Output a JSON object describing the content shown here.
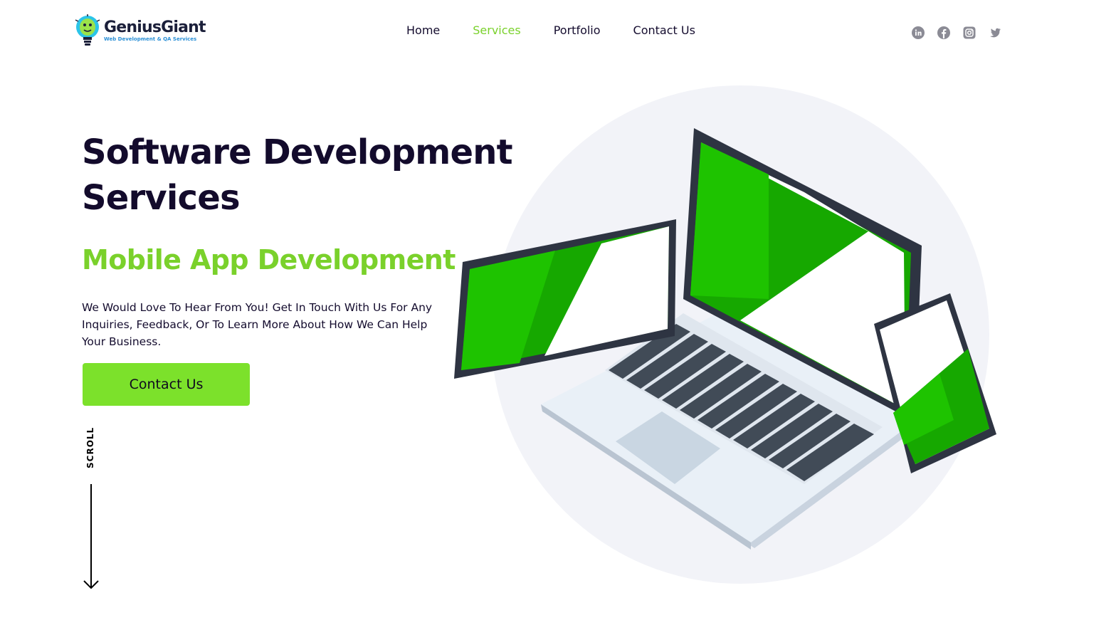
{
  "brand": {
    "name": "GeniusGiant",
    "tagline": "Web Development & QA Services"
  },
  "nav": {
    "items": [
      {
        "label": "Home",
        "active": false
      },
      {
        "label": "Services",
        "active": true
      },
      {
        "label": "Portfolio",
        "active": false
      },
      {
        "label": "Contact Us",
        "active": false
      }
    ]
  },
  "social": {
    "icons": [
      "linkedin-icon",
      "facebook-icon",
      "instagram-icon",
      "twitter-icon"
    ]
  },
  "hero": {
    "title": "Software Development Services",
    "subtitle": "Mobile App Development",
    "description": "We Would Love To Hear From You! Get In Touch With Us For Any Inquiries, Feedback, Or To Learn More About How We Can Help Your Business.",
    "cta_label": "Contact Us",
    "scroll_label": "SCROLL"
  },
  "colors": {
    "accent": "#7ad12b",
    "button": "#7ce12b",
    "heading": "#130b2c",
    "screen_green": "#16a800",
    "circle_bg": "#f2f3f8"
  }
}
